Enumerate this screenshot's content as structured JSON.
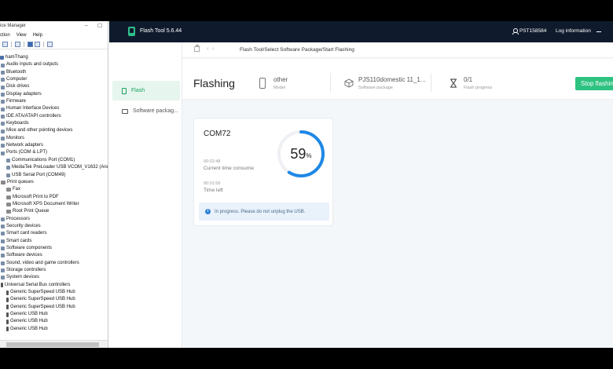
{
  "device_manager": {
    "title": "ice Manager",
    "window_buttons": [
      "–",
      "☐"
    ],
    "menu": [
      "ction",
      "View",
      "Help"
    ],
    "tree": [
      {
        "label": "hamThang",
        "indent": 0,
        "icon": "computer-icon"
      },
      {
        "label": "Audio inputs and outputs",
        "indent": 1,
        "icon": "speaker-icon"
      },
      {
        "label": "Bluetooth",
        "indent": 1,
        "icon": "bluetooth-icon"
      },
      {
        "label": "Computer",
        "indent": 1,
        "icon": "computer-icon"
      },
      {
        "label": "Disk drives",
        "indent": 1,
        "icon": "disk-icon"
      },
      {
        "label": "Display adapters",
        "indent": 1,
        "icon": "display-icon"
      },
      {
        "label": "Firmware",
        "indent": 1,
        "icon": "chip-icon"
      },
      {
        "label": "Human Interface Devices",
        "indent": 1,
        "icon": "hid-icon"
      },
      {
        "label": "IDE ATA/ATAPI controllers",
        "indent": 1,
        "icon": "controller-icon"
      },
      {
        "label": "Keyboards",
        "indent": 1,
        "icon": "keyboard-icon"
      },
      {
        "label": "Mice and other pointing devices",
        "indent": 1,
        "icon": "mouse-icon"
      },
      {
        "label": "Monitors",
        "indent": 1,
        "icon": "monitor-icon"
      },
      {
        "label": "Network adapters",
        "indent": 1,
        "icon": "network-icon"
      },
      {
        "label": "Ports (COM & LPT)",
        "indent": 1,
        "icon": "port-icon"
      },
      {
        "label": "Communications Port (COM1)",
        "indent": 2,
        "icon": "port-icon"
      },
      {
        "label": "MediaTek PreLoader USB VCOM_V1632 (And",
        "indent": 2,
        "icon": "port-icon"
      },
      {
        "label": "USB Serial Port (COM49)",
        "indent": 2,
        "icon": "port-icon"
      },
      {
        "label": "Print queues",
        "indent": 1,
        "icon": "printer-icon"
      },
      {
        "label": "Fax",
        "indent": 2,
        "icon": "printer-icon"
      },
      {
        "label": "Microsoft Print to PDF",
        "indent": 2,
        "icon": "printer-icon"
      },
      {
        "label": "Microsoft XPS Document Writer",
        "indent": 2,
        "icon": "printer-icon"
      },
      {
        "label": "Root Print Queue",
        "indent": 2,
        "icon": "printer-icon"
      },
      {
        "label": "Processors",
        "indent": 1,
        "icon": "processor-icon"
      },
      {
        "label": "Security devices",
        "indent": 1,
        "icon": "security-icon"
      },
      {
        "label": "Smart card readers",
        "indent": 1,
        "icon": "smartcard-icon"
      },
      {
        "label": "Smart cards",
        "indent": 1,
        "icon": "smartcard-icon"
      },
      {
        "label": "Software components",
        "indent": 1,
        "icon": "component-icon"
      },
      {
        "label": "Software devices",
        "indent": 1,
        "icon": "component-icon"
      },
      {
        "label": "Sound, video and game controllers",
        "indent": 1,
        "icon": "speaker-icon"
      },
      {
        "label": "Storage controllers",
        "indent": 1,
        "icon": "storage-icon"
      },
      {
        "label": "System devices",
        "indent": 1,
        "icon": "system-icon"
      },
      {
        "label": "Universal Serial Bus controllers",
        "indent": 1,
        "icon": "usb-icon"
      },
      {
        "label": "Generic SuperSpeed USB Hub",
        "indent": 2,
        "icon": "usb-icon"
      },
      {
        "label": "Generic SuperSpeed USB Hub",
        "indent": 2,
        "icon": "usb-icon"
      },
      {
        "label": "Generic SuperSpeed USB Hub",
        "indent": 2,
        "icon": "usb-icon"
      },
      {
        "label": "Generic USB Hub",
        "indent": 2,
        "icon": "usb-icon"
      },
      {
        "label": "Generic USB Hub",
        "indent": 2,
        "icon": "usb-icon"
      },
      {
        "label": "Generic USB Hub",
        "indent": 2,
        "icon": "usb-icon"
      }
    ]
  },
  "flash_tool": {
    "app_title": "Flash Tool 5.6.44",
    "user_id": "PST158584",
    "log_info": "Log information",
    "nav": [
      {
        "label": "Flash",
        "icon": "flash-icon",
        "active": true
      },
      {
        "label": "Software packag...",
        "icon": "package-icon",
        "active": false
      }
    ],
    "breadcrumb": "Flash Tool/Select Software Package/Start Flashing",
    "page_title": "Flashing",
    "stats": [
      {
        "value": "other",
        "label": "Model",
        "icon": "phone-icon"
      },
      {
        "value": "PJS110domestic 11_1...",
        "label": "Software package",
        "icon": "package-icon"
      },
      {
        "value": "0/1",
        "label": "Flash progress",
        "icon": "hourglass-icon"
      }
    ],
    "stop_button": "Stop flashing",
    "card": {
      "port": "COM72",
      "time_consumed_value": "00:02:48",
      "time_consumed_label": "Current time consume",
      "time_left_value": "00:01:56",
      "time_left_label": "Time left",
      "progress_percent": 59,
      "progress_text": "59",
      "progress_unit": "%",
      "notice": "In progress. Please do not unplug the USB."
    },
    "colors": {
      "header_bg": "#0f1b2d",
      "accent_green": "#2ec280",
      "progress_blue": "#1e88e5",
      "notice_bg": "#e9f2fb"
    }
  }
}
